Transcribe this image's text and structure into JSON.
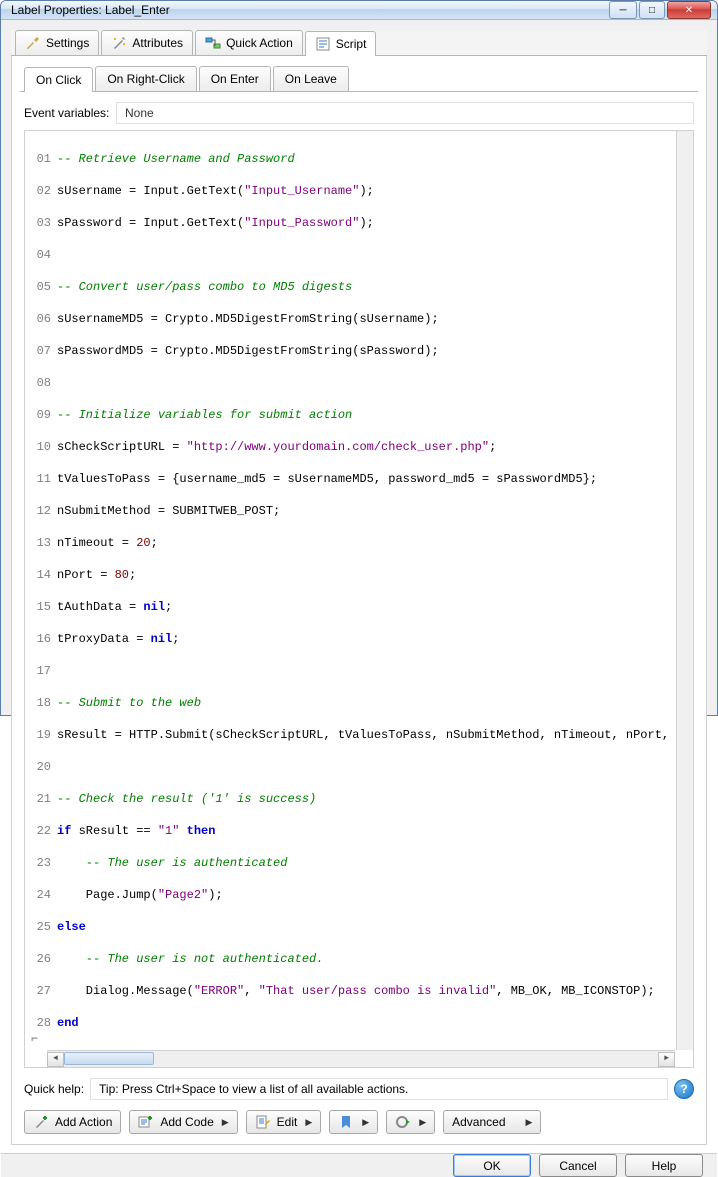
{
  "window": {
    "title": "Label Properties: Label_Enter"
  },
  "winbtns": {
    "min": "─",
    "max": "□",
    "close": "✕"
  },
  "toptabs": {
    "settings": "Settings",
    "attributes": "Attributes",
    "quickaction": "Quick Action",
    "script": "Script"
  },
  "subtabs": {
    "onclick": "On Click",
    "onright": "On Right-Click",
    "onenter": "On Enter",
    "onleave": "On Leave"
  },
  "eventvars": {
    "label": "Event variables:",
    "value": "None"
  },
  "code": {
    "l01": "-- Retrieve Username and Password",
    "l02a": "sUsername = Input.GetText(",
    "l02s": "\"Input_Username\"",
    "l02b": ");",
    "l03a": "sPassword = Input.GetText(",
    "l03s": "\"Input_Password\"",
    "l03b": ");",
    "l05": "-- Convert user/pass combo to MD5 digests",
    "l06": "sUsernameMD5 = Crypto.MD5DigestFromString(sUsername);",
    "l07": "sPasswordMD5 = Crypto.MD5DigestFromString(sPassword);",
    "l09": "-- Initialize variables for submit action",
    "l10a": "sCheckScriptURL = ",
    "l10s": "\"http://www.yourdomain.com/check_user.php\"",
    "l10b": ";",
    "l11": "tValuesToPass = {username_md5 = sUsernameMD5, password_md5 = sPasswordMD5};",
    "l12": "nSubmitMethod = SUBMITWEB_POST;",
    "l13a": "nTimeout = ",
    "l13n": "20",
    "l13b": ";",
    "l14a": "nPort = ",
    "l14n": "80",
    "l14b": ";",
    "l15a": "tAuthData = ",
    "l15k": "nil",
    "l15b": ";",
    "l16a": "tProxyData = ",
    "l16k": "nil",
    "l16b": ";",
    "l18": "-- Submit to the web",
    "l19": "sResult = HTTP.Submit(sCheckScriptURL, tValuesToPass, nSubmitMethod, nTimeout, nPort,",
    "l21": "-- Check the result ('1' is success)",
    "l22a": "if",
    "l22b": " sResult == ",
    "l22s": "\"1\"",
    "l22c": " ",
    "l22d": "then",
    "l23": "    -- The user is authenticated",
    "l24a": "    Page.Jump(",
    "l24s": "\"Page2\"",
    "l24b": ");",
    "l25": "else",
    "l26": "    -- The user is not authenticated.",
    "l27a": "    Dialog.Message(",
    "l27s1": "\"ERROR\"",
    "l27b": ", ",
    "l27s2": "\"That user/pass combo is invalid\"",
    "l27c": ", MB_OK, MB_ICONSTOP);",
    "l28": "end"
  },
  "quickhelp": {
    "label": "Quick help:",
    "value": "Tip: Press Ctrl+Space to view a list of all available actions."
  },
  "buttons": {
    "addaction": "Add Action",
    "addcode": "Add Code",
    "edit": "Edit",
    "advanced": "Advanced"
  },
  "dialog": {
    "ok": "OK",
    "cancel": "Cancel",
    "help": "Help"
  }
}
